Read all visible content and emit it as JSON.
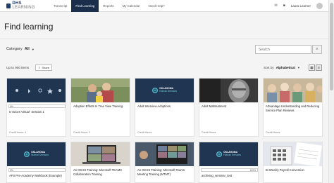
{
  "nav": {
    "logo_main": "DHS",
    "logo_sub": "LEARNING",
    "tabs": [
      "Transcript",
      "Find Learning",
      "Reports",
      "My Calendar",
      "Need Help?"
    ],
    "active_tab": 1,
    "user_name": "Laura Learner"
  },
  "page": {
    "title": "Find learning",
    "category_label": "Category",
    "category_value": "All",
    "search_placeholder": "Search",
    "count_text": "Up to 900 items",
    "share_label": "Share",
    "sort_label": "Sort by",
    "sort_value": "Alphabetical"
  },
  "cards_row1": [
    {
      "title": "5 Voices Virtual- Session 1",
      "credit": "Credit Hours: 4",
      "progress": "0%",
      "progress_value": 0
    },
    {
      "title": "Adoption Efforts In Tree View Training",
      "credit": "Credit Hours: 2"
    },
    {
      "title": "Adult Interview Adoptions",
      "credit": "Credit Hours:"
    },
    {
      "title": "Adult Maltreatment",
      "credit": "Credit Hours:"
    },
    {
      "title": "ADvantage Understanding and Reducing Service Plan Reviews",
      "credit": "Credit Hours:"
    }
  ],
  "cards_row2": [
    {
      "title": "AFS Pre-Academy Workbook (Example)",
      "progress": "0%",
      "progress_value": 0
    },
    {
      "title": "An OKHS Training: Microsoft TEAMS Collaboration Training"
    },
    {
      "title": "An OKHS Training: Microsoft Teams Meeting Training (MTMT)"
    },
    {
      "title": "archiving_seminar_test",
      "progress": "100%",
      "progress_value": 100
    },
    {
      "title": "Bi Weekly Payroll Conversion"
    }
  ],
  "ok_logo": {
    "line1": "OKLAHOMA",
    "line2": "Human Services"
  }
}
